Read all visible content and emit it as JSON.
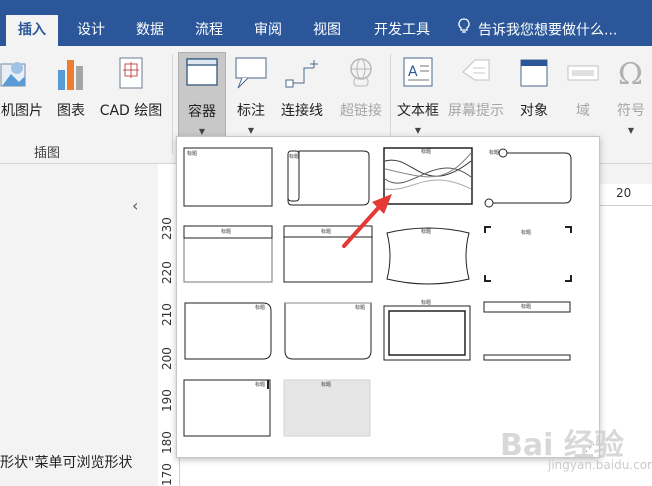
{
  "tabs": [
    {
      "label": "插入",
      "active": true
    },
    {
      "label": "设计"
    },
    {
      "label": "数据"
    },
    {
      "label": "流程"
    },
    {
      "label": "审阅"
    },
    {
      "label": "视图"
    },
    {
      "label": "开发工具"
    }
  ],
  "tell_me": "告诉我您想要做什么...",
  "ribbon": {
    "online_pictures": "机图片",
    "chart": "图表",
    "cad_drawing": "CAD 绘图",
    "container": "容器",
    "callout": "标注",
    "connector": "连接线",
    "hyperlink": "超链接",
    "textbox": "文本框",
    "screentip": "屏幕提示",
    "object": "对象",
    "field": "域",
    "symbol": "符号",
    "group_illustrations": "插图"
  },
  "ruler": {
    "v_ticks": [
      "230",
      "220",
      "210",
      "200",
      "190",
      "180",
      "170"
    ],
    "h_tick": "20"
  },
  "left_pane_text": "形状\"菜单可浏览形状",
  "gallery": {
    "item_titles": [
      "标题",
      "标题",
      "标题",
      "标题",
      "标题",
      "标题",
      "标题",
      "标题",
      "标题",
      "标题",
      "标题",
      "标题",
      "标题",
      "标题"
    ]
  },
  "watermark": "Bai 经验",
  "watermark_sub": "jingyan.baidu.com",
  "colors": {
    "accent": "#2b579a",
    "arrow": "#e53935"
  }
}
